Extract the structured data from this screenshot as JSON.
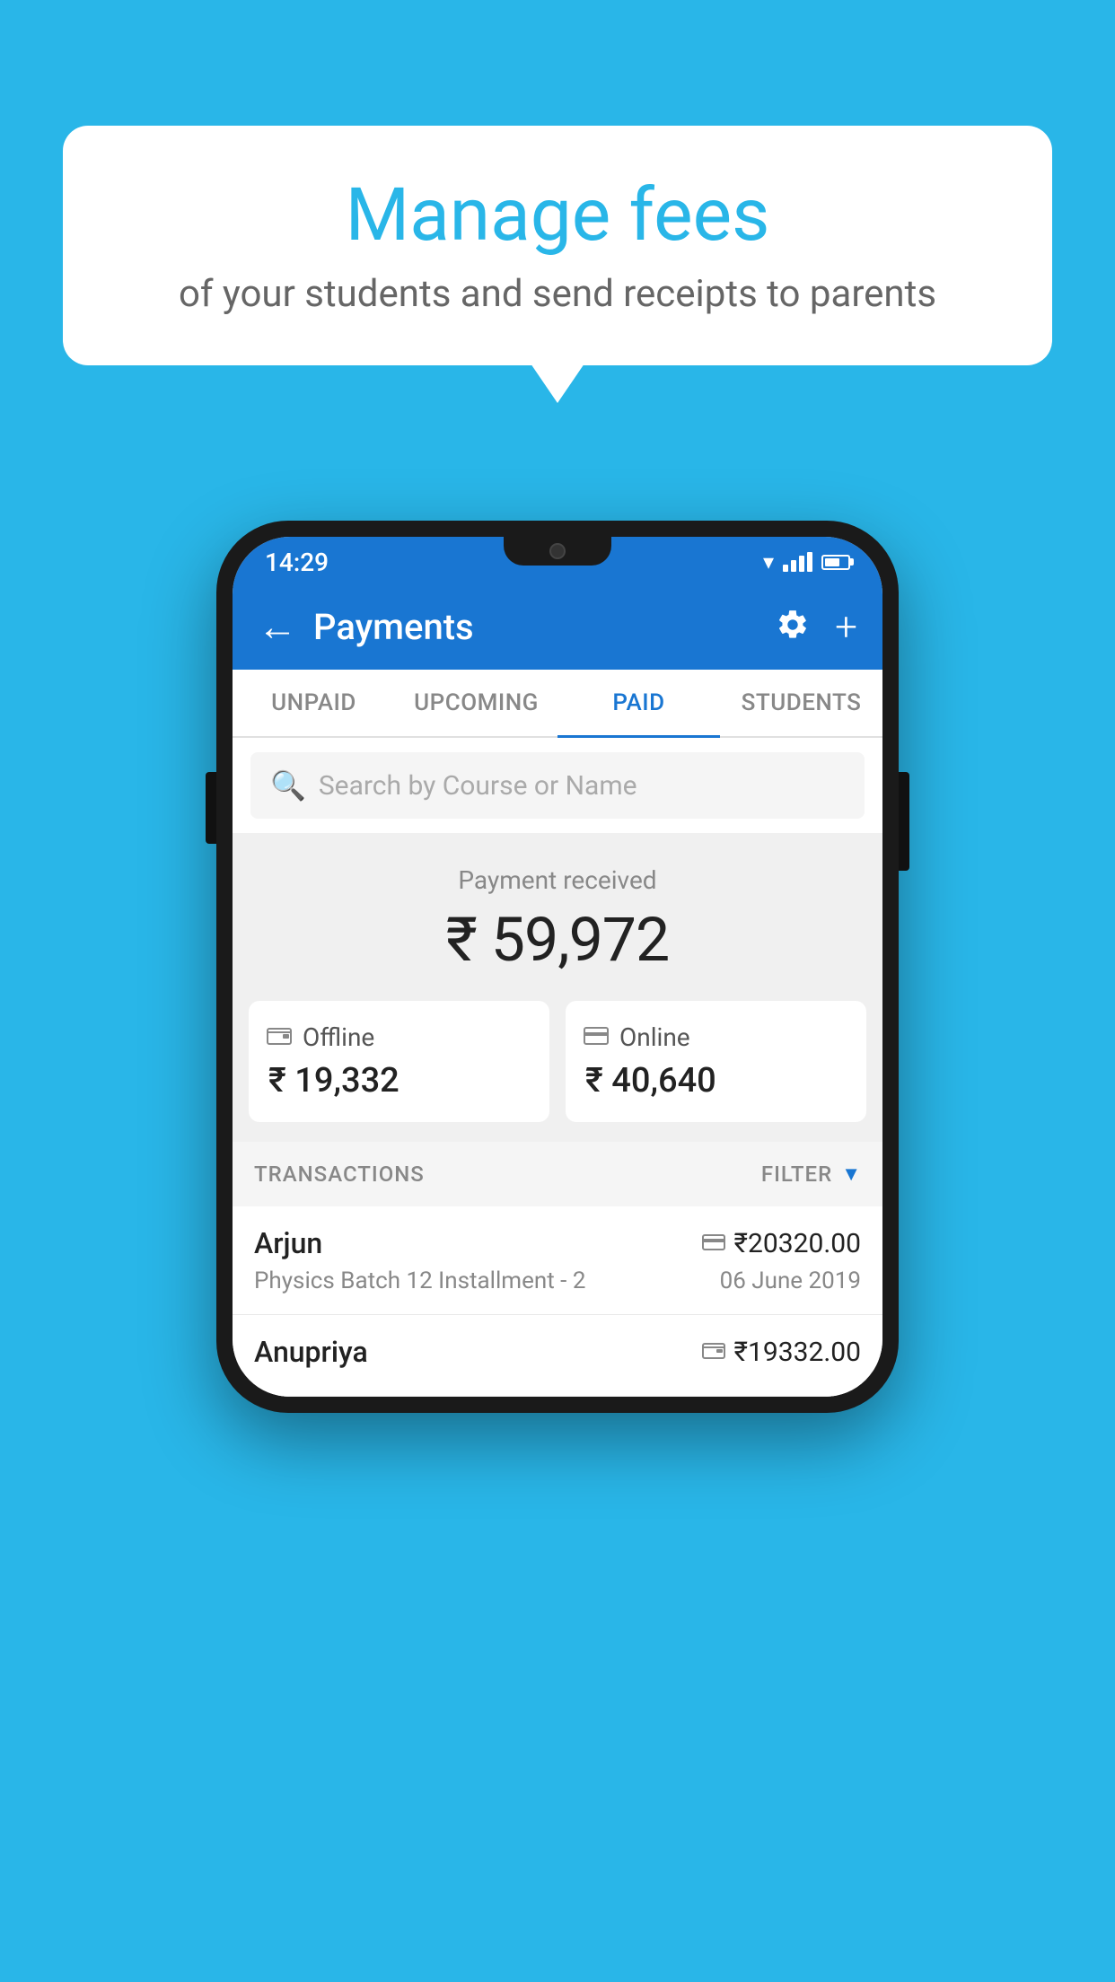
{
  "background_color": "#29b6e8",
  "bubble": {
    "title": "Manage fees",
    "subtitle": "of your students and send receipts to parents"
  },
  "phone": {
    "status_bar": {
      "time": "14:29"
    },
    "app_bar": {
      "title": "Payments",
      "back_label": "←",
      "plus_label": "+"
    },
    "tabs": [
      {
        "label": "UNPAID",
        "active": false
      },
      {
        "label": "UPCOMING",
        "active": false
      },
      {
        "label": "PAID",
        "active": true
      },
      {
        "label": "STUDENTS",
        "active": false
      }
    ],
    "search": {
      "placeholder": "Search by Course or Name"
    },
    "payment_summary": {
      "label": "Payment received",
      "amount": "₹ 59,972",
      "offline_label": "Offline",
      "offline_amount": "₹ 19,332",
      "online_label": "Online",
      "online_amount": "₹ 40,640"
    },
    "transactions": {
      "header_label": "TRANSACTIONS",
      "filter_label": "FILTER",
      "items": [
        {
          "name": "Arjun",
          "course": "Physics Batch 12 Installment - 2",
          "amount": "₹20320.00",
          "date": "06 June 2019",
          "payment_type": "online"
        },
        {
          "name": "Anupriya",
          "course": "",
          "amount": "₹19332.00",
          "date": "",
          "payment_type": "offline"
        }
      ]
    }
  }
}
